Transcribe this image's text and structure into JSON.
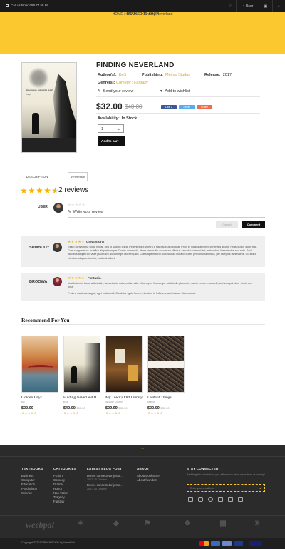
{
  "topbar": {
    "call": "Call us Now: 088 77 55 66",
    "user_label": "User"
  },
  "header": {
    "shop_name": "BRAINFOOD SHOP",
    "breadcrumb": "HOME > BOOKS > Finding Neverland"
  },
  "product": {
    "cover_title": "FINDING NEVERLAND",
    "cover_author": "Keiji",
    "title": "FINDING NEVERLAND",
    "authors_label": "Author(s):",
    "author": "Keiji",
    "publishing_label": "Publishing:",
    "publisher": "Meimo Studiu",
    "release_label": "Release:",
    "release": "2017",
    "genres_label": "Genre(s):",
    "genre_1": "Comedy",
    "genre_sep": " ; ",
    "genre_2": "Fantasy",
    "send_review": "Send your review",
    "add_wishlist": "Add to wishlist",
    "price": "$32.00",
    "old_price": "$40.00",
    "share_like": "Like 2",
    "share_tweet": "Tweet",
    "share_share": "Share",
    "availability_label": "Availability:",
    "availability": "In Stock",
    "quantity": "1",
    "add_to_cart": "Add to cart"
  },
  "tabs": {
    "description": "DESCRIPTION",
    "reviews": "REVIEWS"
  },
  "reviews": {
    "rating": 4.5,
    "count_label": "2 reviews",
    "user_label": "USER",
    "write_placeholder": "Write your review",
    "cancel": "Cancel",
    "comment": "Comment",
    "items": [
      {
        "name": "SUMBOOY",
        "stars": 4,
        "headline": "Great story!",
        "text": "Etiam consectetur porta mollis. Sed ut sagittis tellus. Pellentesque viverra a nisi dapibus volutpat. Proin et magna at libero venenatis auctor. Phasellus in dolor erat. Cras congue risus ac tellus aliquet semper. Donec commodo, libero venenatis accumsan efficitur, sem dui euismod est, in tincidunt libero lectus sed ante. Sed faucibus aliquet leo vitae placerat!!! Nullam eget laoreet justo. Class aptent taciti sociosqu ad litora torquent per conubia nostra, per inceptos himenaeos. Curabitur interdum aliquam lacinia, mattis tincidunt."
      },
      {
        "name": "BROOWA",
        "stars": 5,
        "headline": "Fantasic.",
        "text": "Vestibulum in lacus sollicitudin, laoreet ante quis, mollis nulla. Ut semper, libero eget sollicitudin placerat, mauris ex commodo elit, sed volutpat dolor turpis sed urna.",
        "text2": "Proin a maximus augue, eget mattis nisl. Curabitur ligula lorem, interdum id finibus a, scelerisque vitae massa."
      }
    ]
  },
  "recommend": {
    "title": "Recommend For You",
    "items": [
      {
        "name": "Golden Days",
        "author": "Bo",
        "price": "$20.00",
        "old": "",
        "stars": 5
      },
      {
        "name": "Finding Neverland II",
        "author": "Keiji",
        "price": "$40.00",
        "old": "$50.00",
        "stars": 5
      },
      {
        "name": "My Town's Old Library",
        "author": "Woody Cleary",
        "price": "$29.99",
        "old": "$30.00",
        "stars": 5
      },
      {
        "name": "Le Petit Things",
        "author": "Mardo",
        "price": "$20.00",
        "old": "$30.00",
        "stars": 5
      }
    ]
  },
  "footer": {
    "textbooks": {
      "title": "TEXTBOOKS",
      "items": [
        "Business",
        "Computer",
        "Education",
        "Psychology",
        "Science"
      ]
    },
    "categories": {
      "title": "CATEGORIES",
      "items": [
        "Fiction",
        "Comedy",
        "Drama",
        "Horror",
        "Non-fiction",
        "Tragedy",
        "Fantasy"
      ]
    },
    "blog": {
      "title": "LATEST BLOG POST",
      "posts": [
        {
          "title": "Donec consectetur justo...",
          "date": "2017, 20 October"
        },
        {
          "title": "Donec consectetur justo...",
          "date": "2017, 20 October"
        }
      ]
    },
    "about": {
      "title": "ABOUT",
      "items": [
        "About Bookstore",
        "About founders"
      ]
    },
    "stay": {
      "title": "STAY CONNECTED",
      "text": "Be fitting the form below, you will receive latest news from us weekly!",
      "placeholder": "Enter your email here"
    },
    "copyright": "Copyright © 2017 BRAINFOOD by WeebPal",
    "sponsor_1": "weebpal"
  },
  "colors": {
    "accent": "#fcc82f",
    "link": "#d8a21d",
    "dark": "#111111",
    "footer": "#2b2b2b"
  }
}
